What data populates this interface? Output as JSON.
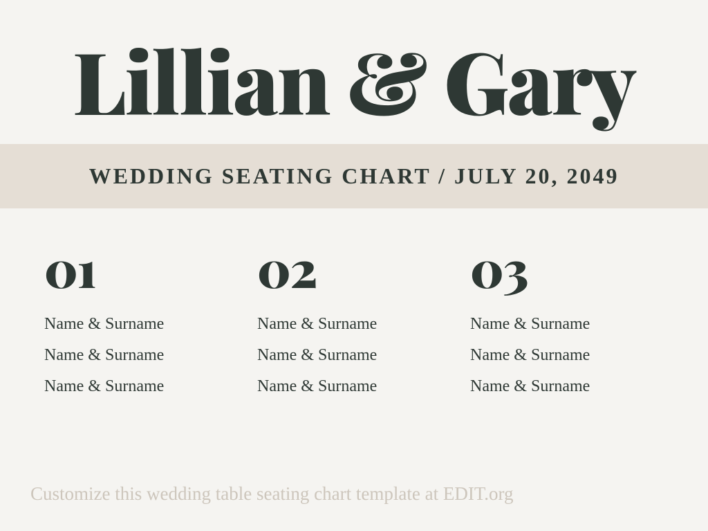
{
  "title": "Lillian & Gary",
  "subtitle": "WEDDING SEATING CHART / JULY 20, 2049",
  "tables": [
    {
      "number": "01",
      "guests": [
        "Name & Surname",
        "Name & Surname",
        "Name & Surname"
      ]
    },
    {
      "number": "02",
      "guests": [
        "Name & Surname",
        "Name & Surname",
        "Name & Surname"
      ]
    },
    {
      "number": "03",
      "guests": [
        "Name & Surname",
        "Name & Surname",
        "Name & Surname"
      ]
    }
  ],
  "footer": "Customize this wedding table seating chart template at EDIT.org"
}
